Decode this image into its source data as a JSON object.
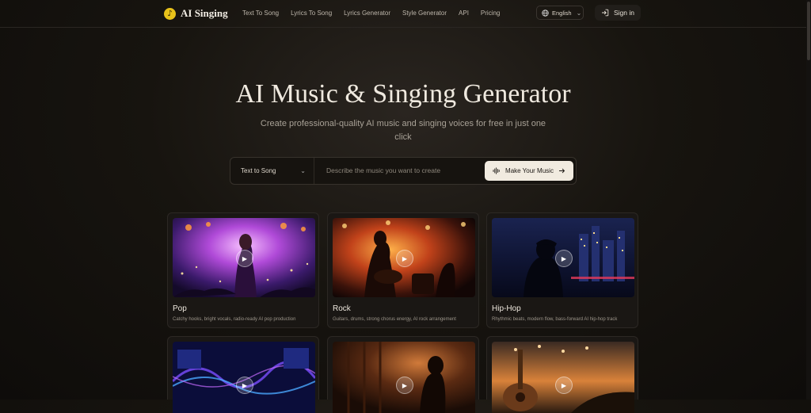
{
  "brand": {
    "name": "AI Singing",
    "logo_icon": "music-note-icon"
  },
  "nav": {
    "links": [
      "Text To Song",
      "Lyrics To Song",
      "Lyrics Generator",
      "Style Generator",
      "API",
      "Pricing"
    ],
    "language": "English",
    "signin": "Sign in"
  },
  "hero": {
    "title": "AI Music & Singing Generator",
    "subtitle": "Create professional-quality AI music and singing voices for free in just one click"
  },
  "search": {
    "mode": "Text to Song",
    "placeholder": "Describe the music you want to create",
    "button": "Make Your Music"
  },
  "cards": [
    {
      "name": "Pop",
      "desc": "Catchy hooks, bright vocals, radio-ready AI pop production"
    },
    {
      "name": "Rock",
      "desc": "Guitars, drums, strong chorus energy, AI rock arrangement"
    },
    {
      "name": "Hip-Hop",
      "desc": "Rhythmic beats, modern flow, bass-forward AI hip-hop track"
    }
  ],
  "colors": {
    "accent": "#f1ebe0",
    "logo": "#e8c21a",
    "background": "#17140f"
  }
}
